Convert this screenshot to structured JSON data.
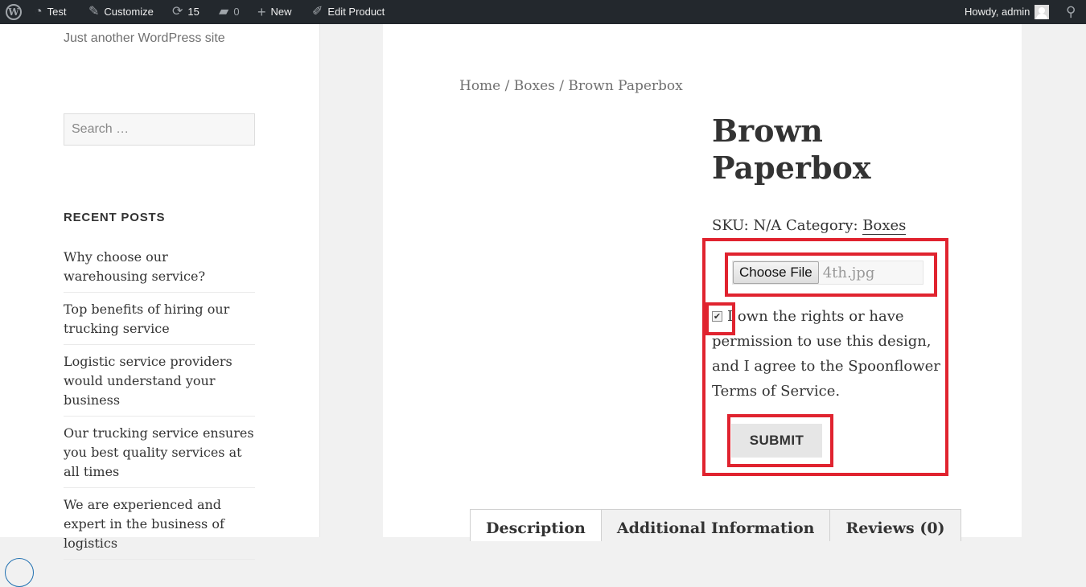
{
  "adminbar": {
    "site_name": "Test",
    "customize": "Customize",
    "updates_count": "15",
    "comments_count": "0",
    "new_label": "New",
    "edit_label": "Edit Product",
    "howdy": "Howdy, admin"
  },
  "sidebar": {
    "description": "Just another WordPress site",
    "search_placeholder": "Search …",
    "widget_title": "RECENT POSTS",
    "posts": [
      "Why choose our warehousing service?",
      "Top benefits of hiring our trucking service",
      "Logistic service providers would understand your business",
      "Our trucking service ensures you best quality services at all times",
      "We are experienced and expert in the business of logistics"
    ]
  },
  "product": {
    "breadcrumb": "Home / Boxes / Brown Paperbox",
    "title": "Brown Paperbox",
    "sku_label": "SKU: N/A Category: ",
    "category": "Boxes",
    "choose_file": "Choose File",
    "file_name": "4th.jpg",
    "agree_text": "I own the rights or have permission to use this design, and I agree to the Spoonflower Terms of Service.",
    "submit": "SUBMIT",
    "tabs": [
      "Description",
      "Additional Information",
      "Reviews (0)"
    ]
  },
  "colors": {
    "adminbar": "#23282d",
    "highlight": "#e0232f"
  },
  "icons": [
    "wordpress-icon",
    "dashboard-icon",
    "brush-icon",
    "updates-icon",
    "comment-icon",
    "plus-icon",
    "pencil-icon",
    "user-avatar-icon",
    "search-icon"
  ]
}
